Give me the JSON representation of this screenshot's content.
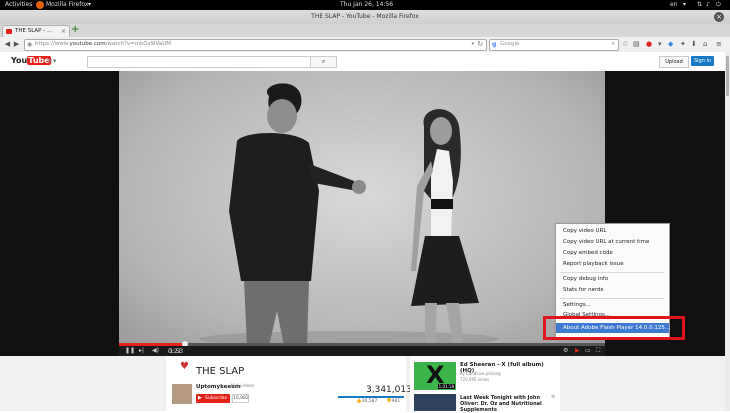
{
  "topbar": {
    "activities": "Activities",
    "app": "Mozilla Firefox",
    "clock": "Thu Jan 26, 14:56",
    "lang": "en"
  },
  "window": {
    "title": "THE SLAP - YouTube - Mozilla Firefox"
  },
  "tab": {
    "label": "THE SLAP - ..."
  },
  "nav": {
    "url_prefix": "https://www.",
    "url_host": "youtube.com",
    "url_path": "/watch?v=mkOz9lVaUM",
    "search_placeholder": "Google"
  },
  "youtube": {
    "logo_you": "You",
    "logo_tube": "Tube",
    "upload": "Upload",
    "signin": "Sign in",
    "video": {
      "title": "THE SLAP",
      "channel": "Uptomykeeem",
      "channel_videos": "494 videos",
      "subscribe": "Subscribe",
      "subscribers": "10,982",
      "views": "3,341,013",
      "likes": "36,587",
      "dislikes": "981",
      "time_current": "0:21",
      "time_total": "1:53"
    }
  },
  "context_menu": {
    "items": [
      "Copy video URL",
      "Copy video URL at current time",
      "Copy embed code",
      "Report playback issue",
      "Copy debug info",
      "Stats for nerds",
      "Settings...",
      "Global Settings...",
      "About Adobe Flash Player 14.0.0.125..."
    ]
  },
  "related": [
    {
      "title": "Ed Sheeran - X (full album) (HQ)",
      "channel": "by bandlove.philang",
      "views": "720,995 views",
      "badge": "1:01:18"
    },
    {
      "title": "Last Week Tonight with John Oliver: Dr. Oz and Nutritional Supplements",
      "channel": "",
      "views": "",
      "badge": ""
    }
  ],
  "colors": {
    "yt_red": "#e62117",
    "signin_blue": "#167ac6",
    "menu_highlight": "#3d7bd0",
    "annotation_red": "#e0141c",
    "album_green": "#3bb54a"
  }
}
